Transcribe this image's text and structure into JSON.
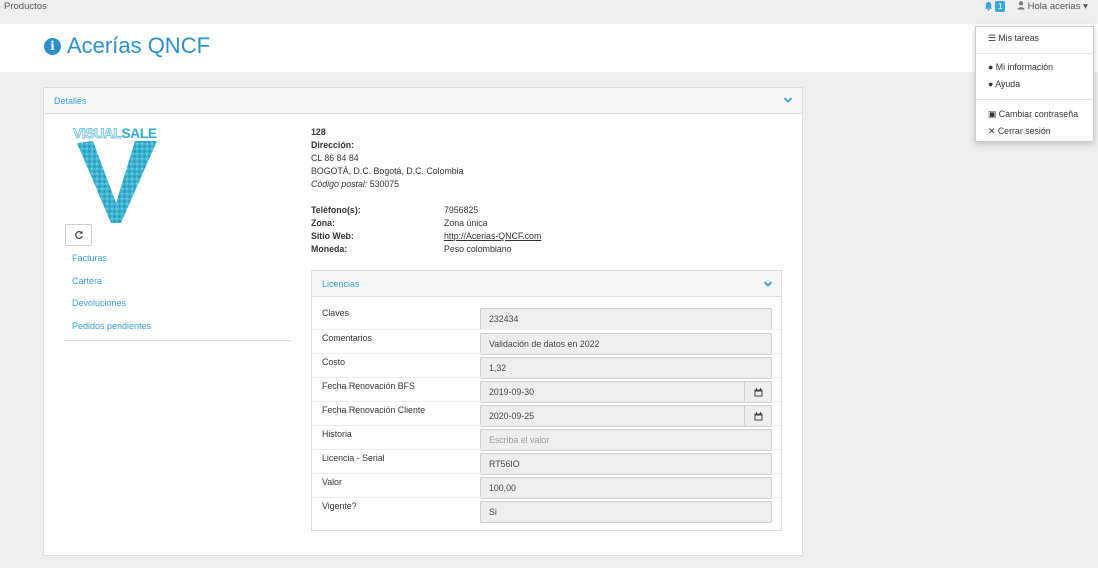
{
  "topbar": {
    "left_label": "Productos",
    "notif_count": "1",
    "user_label": "Hola acerias"
  },
  "page": {
    "title": "Acerías QNCF"
  },
  "details": {
    "title": "Detalles"
  },
  "logo": {
    "text_visual": "VISUAL",
    "text_sale": "SALE"
  },
  "sidebar": {
    "links": [
      "Facturas",
      "Cartera",
      "Devoluciones",
      "Pedidos pendientes"
    ]
  },
  "company": {
    "code": "128",
    "address_label": "Dirección:",
    "address_line1": "CL 86 84 84",
    "address_line2": "BOGOTÁ, D.C. Bogotá, D.C. Colombia",
    "postal_label": "Código postal:",
    "postal_value": "530075",
    "fields": [
      {
        "key": "Teléfono(s):",
        "value": "7956825"
      },
      {
        "key": "Zona:",
        "value": "Zona única"
      },
      {
        "key": "Sitio Web:",
        "value": "http://Acerias-QNCF.com"
      },
      {
        "key": "Moneda:",
        "value": "Peso colombiano"
      }
    ]
  },
  "licencias": {
    "title": "Licencias",
    "rows": [
      {
        "label": "Claves",
        "value": "232434"
      },
      {
        "label": "Comentarios",
        "value": "Validación de datos en 2022"
      },
      {
        "label": "Costo",
        "value": "1,32"
      },
      {
        "label": "Fecha Renovación BFS",
        "value": "2019-09-30"
      },
      {
        "label": "Fecha Renovación Cliente",
        "value": "2020-09-25"
      },
      {
        "label": "Historia",
        "placeholder": "Escriba el valor"
      },
      {
        "label": "Licencia - Serial",
        "value": "RT56IO"
      },
      {
        "label": "Valor",
        "value": "100,00"
      },
      {
        "label": "Vigente?",
        "value": "Si"
      }
    ]
  },
  "user_menu": {
    "items": [
      "Mis tareas",
      "Mi información",
      "Ayuda",
      "Cambiar contraseña",
      "Cerrar sesión"
    ]
  },
  "colors": {
    "accent": "#2b8fc9",
    "link": "#3a9ed5"
  }
}
